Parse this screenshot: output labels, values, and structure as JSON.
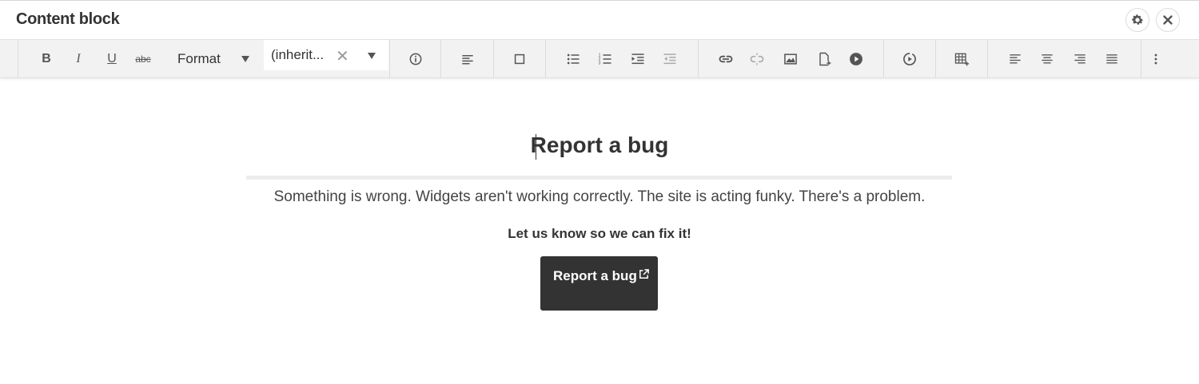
{
  "window": {
    "title": "Content block"
  },
  "toolbar": {
    "bold": "B",
    "italic": "I",
    "underline": "U",
    "strikethrough": "abc",
    "format_label": "Format",
    "font_value": "(inherit...",
    "font_clear": "✕"
  },
  "content": {
    "heading": "Report a bug",
    "lead": "Something is wrong. Widgets aren't working correctly. The site is acting funky. There's a problem.",
    "cta_text": "Let us know so we can fix it!",
    "button_label": "Report a bug"
  },
  "icons": {
    "settings": "gear-icon",
    "close": "close-icon",
    "external_link": "external-link-icon"
  },
  "colors": {
    "button_bg": "#333333",
    "toolbar_bg": "#f2f2f2",
    "icon": "#555555"
  }
}
